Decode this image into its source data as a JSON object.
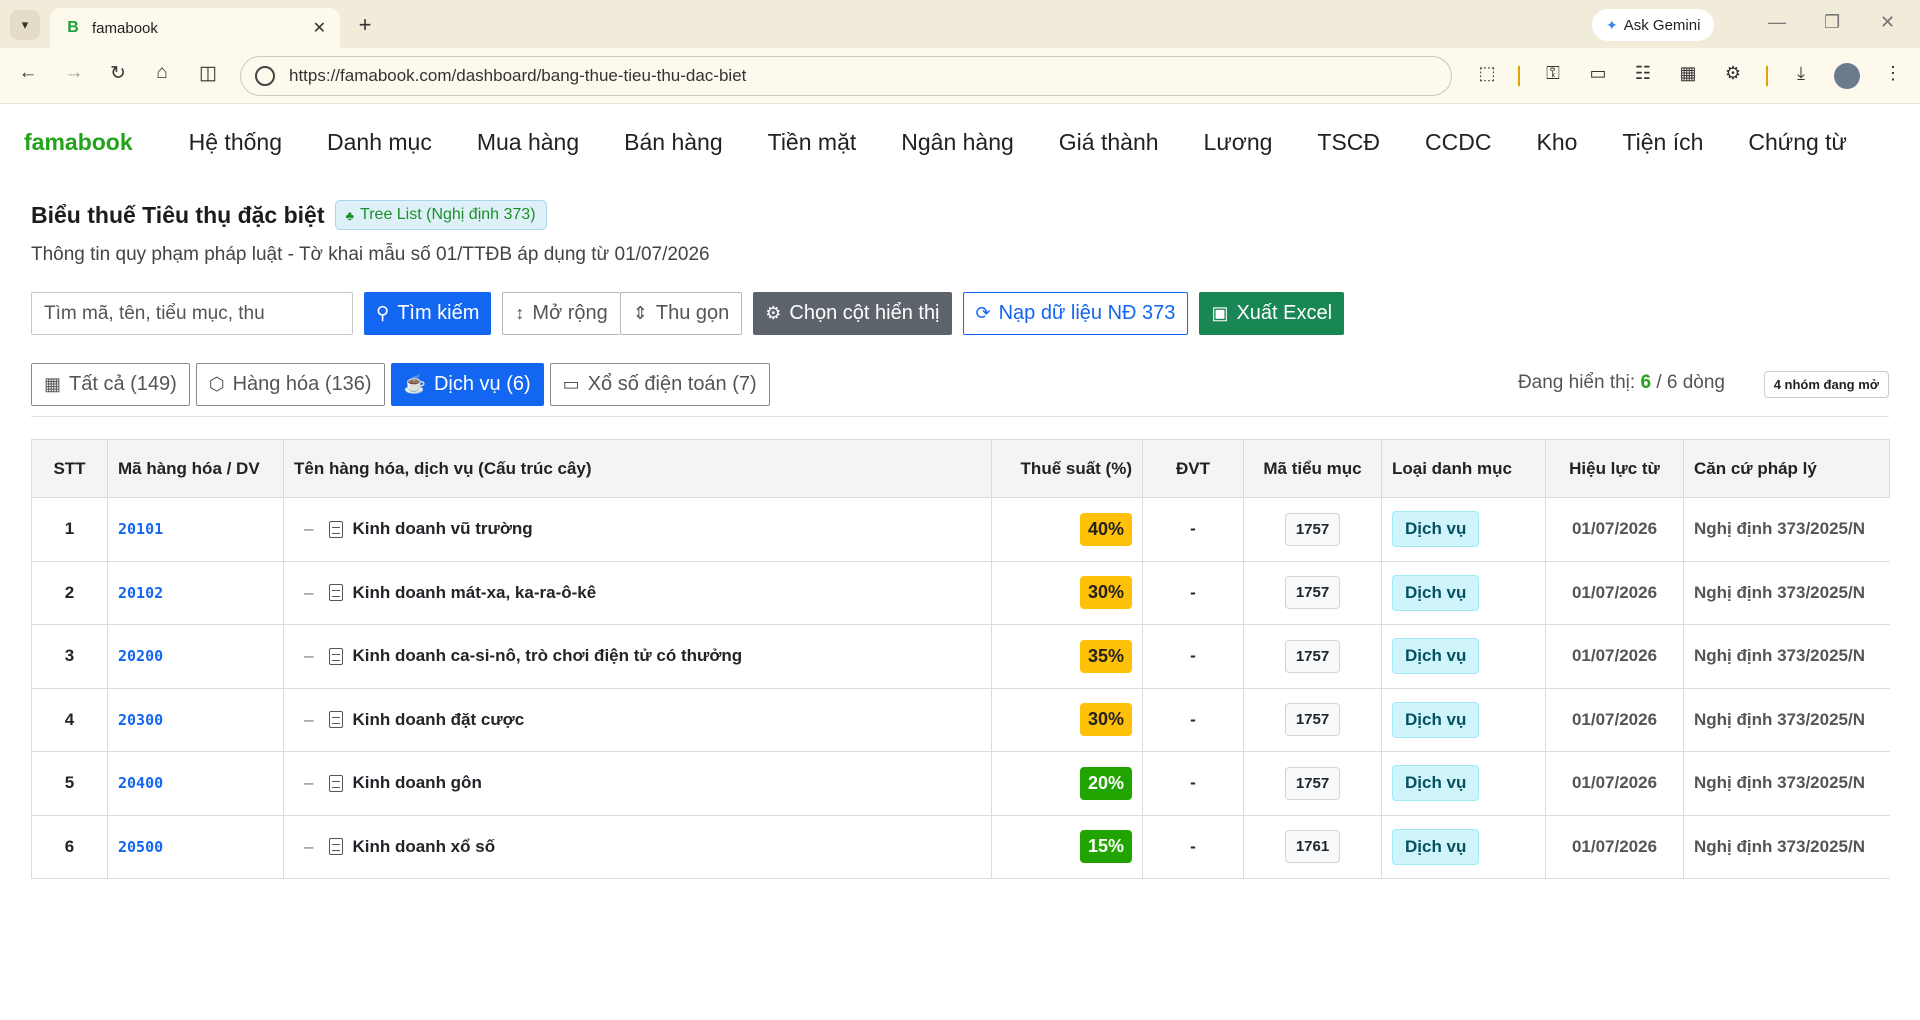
{
  "browser": {
    "tab_title": "famabook",
    "tab_favicon": "B",
    "url": "https://famabook.com/dashboard/bang-thue-tieu-thu-dac-biet",
    "ask_gemini": "Ask Gemini"
  },
  "app": {
    "brand": "famabook",
    "menu": [
      "Hệ thống",
      "Danh mục",
      "Mua hàng",
      "Bán hàng",
      "Tiền mặt",
      "Ngân hàng",
      "Giá thành",
      "Lương",
      "TSCĐ",
      "CCDC",
      "Kho",
      "Tiện ích",
      "Chứng từ"
    ]
  },
  "header": {
    "title": "Biểu thuế Tiêu thụ đặc biệt",
    "badge": "Tree List (Nghị định 373)",
    "subtitle": "Thông tin quy phạm pháp luật - Tờ khai mẫu số 01/TTĐB áp dụng từ 01/07/2026"
  },
  "toolbar": {
    "search_placeholder": "Tìm mã, tên, tiểu mục, thu",
    "search_button": "Tìm kiếm",
    "expand_button": "Mở rộng",
    "collapse_button": "Thu gọn",
    "columns_button": "Chọn cột hiển thị",
    "load_button": "Nạp dữ liệu NĐ 373",
    "export_button": "Xuất Excel"
  },
  "filters": {
    "tabs": [
      "Tất cả (149)",
      "Hàng hóa (136)",
      "Dịch vụ (6)",
      "Xổ số điện toán (7)"
    ],
    "showing_prefix": "Đang hiển thị:",
    "showing_count": "6",
    "showing_suffix": "/ 6 dòng",
    "open_groups": "4 nhóm đang mở"
  },
  "table": {
    "headers": [
      "STT",
      "Mã hàng hóa / DV",
      "Tên hàng hóa, dịch vụ (Cấu trúc cây)",
      "Thuế suất (%)",
      "ĐVT",
      "Mã tiểu mục",
      "Loại danh mục",
      "Hiệu lực từ",
      "Căn cứ pháp lý"
    ],
    "rows": [
      {
        "stt": "1",
        "code": "20101",
        "name": "Kinh doanh vũ trường",
        "rate": "40%",
        "unit": "-",
        "sub": "1757",
        "category": "Dịch vụ",
        "date": "01/07/2026",
        "law": "Nghị định 373/2025/N"
      },
      {
        "stt": "2",
        "code": "20102",
        "name": "Kinh doanh mát-xa, ka-ra-ô-kê",
        "rate": "30%",
        "unit": "-",
        "sub": "1757",
        "category": "Dịch vụ",
        "date": "01/07/2026",
        "law": "Nghị định 373/2025/N"
      },
      {
        "stt": "3",
        "code": "20200",
        "name": "Kinh doanh ca-si-nô, trò chơi điện tử có thưởng",
        "rate": "35%",
        "unit": "-",
        "sub": "1757",
        "category": "Dịch vụ",
        "date": "01/07/2026",
        "law": "Nghị định 373/2025/N"
      },
      {
        "stt": "4",
        "code": "20300",
        "name": "Kinh doanh đặt cược",
        "rate": "30%",
        "unit": "-",
        "sub": "1757",
        "category": "Dịch vụ",
        "date": "01/07/2026",
        "law": "Nghị định 373/2025/N"
      },
      {
        "stt": "5",
        "code": "20400",
        "name": "Kinh doanh gôn",
        "rate": "20%",
        "unit": "-",
        "sub": "1757",
        "category": "Dịch vụ",
        "date": "01/07/2026",
        "law": "Nghị định 373/2025/N"
      },
      {
        "stt": "6",
        "code": "20500",
        "name": "Kinh doanh xổ số",
        "rate": "15%",
        "unit": "-",
        "sub": "1761",
        "category": "Dịch vụ",
        "date": "01/07/2026",
        "law": "Nghị định 373/2025/N"
      }
    ]
  },
  "colors": {
    "brand": "#22a31b",
    "primary": "#1266f1",
    "rate_high": "#ffc107",
    "rate_low": "#21a300"
  }
}
